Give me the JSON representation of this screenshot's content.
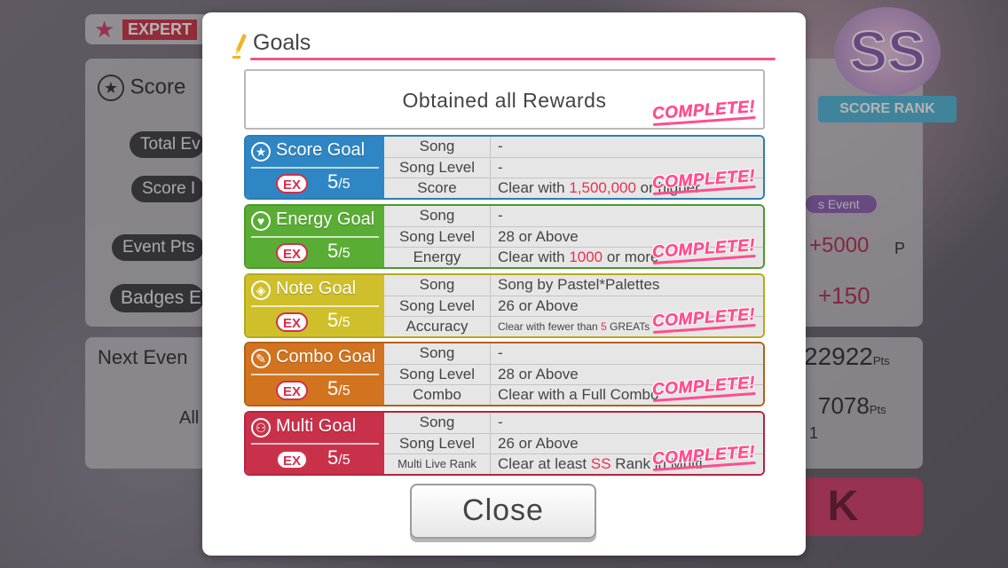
{
  "background": {
    "difficulty": "EXPERT",
    "score_label": "Score",
    "total_label": "Total Ev",
    "score_small": "Score I",
    "event_pts_label": "Event Pts",
    "badges_label": "Badges E",
    "next_event": "Next Even",
    "all_text": "All",
    "score_rank": "SS",
    "score_rank_label": "SCORE RANK",
    "event_label": "s Event",
    "plus_5000": "+5000",
    "p_suffix": "P",
    "plus_150": "+150",
    "pts_1": "22922",
    "pts_2": "7078",
    "pts_unit": "Pts",
    "one": "1"
  },
  "modal": {
    "title": "Goals",
    "all_rewards": "Obtained all Rewards",
    "complete": "COMPLETE!",
    "goals": [
      {
        "name": "Score Goal",
        "icon": "star-icon",
        "ex": "EX",
        "progress": "5",
        "total": "/5",
        "rows": [
          {
            "k": "Song",
            "v": "-"
          },
          {
            "k": "Song Level",
            "v": "-"
          },
          {
            "k": "Score",
            "v_pre": "Clear with ",
            "v_hl": "1,500,000",
            "v_post": " or higher"
          }
        ]
      },
      {
        "name": "Energy Goal",
        "icon": "heart-icon",
        "ex": "EX",
        "progress": "5",
        "total": "/5",
        "rows": [
          {
            "k": "Song",
            "v": "-"
          },
          {
            "k": "Song Level",
            "v": "28 or Above"
          },
          {
            "k": "Energy",
            "v_pre": "Clear with ",
            "v_hl": "1000",
            "v_post": " or more"
          }
        ]
      },
      {
        "name": "Note Goal",
        "icon": "diamond-icon",
        "ex": "EX",
        "progress": "5",
        "total": "/5",
        "rows": [
          {
            "k": "Song",
            "v": "Song by Pastel*Palettes"
          },
          {
            "k": "Song Level",
            "v": "26 or Above"
          },
          {
            "k": "Accuracy",
            "v_pre": "Clear with fewer than ",
            "v_hl": "5",
            "v_post": " GREATs"
          }
        ]
      },
      {
        "name": "Combo Goal",
        "icon": "pen-icon",
        "ex": "EX",
        "progress": "5",
        "total": "/5",
        "rows": [
          {
            "k": "Song",
            "v": "-"
          },
          {
            "k": "Song Level",
            "v": "28 or Above"
          },
          {
            "k": "Combo",
            "v": "Clear with a Full Combo"
          }
        ]
      },
      {
        "name": "Multi Goal",
        "icon": "people-icon",
        "ex": "EX",
        "progress": "5",
        "total": "/5",
        "rows": [
          {
            "k": "Song",
            "v": "-"
          },
          {
            "k": "Song Level",
            "v": "26 or Above"
          },
          {
            "k": "Multi Live Rank",
            "v_pre": "Clear at least ",
            "v_hl": "SS",
            "v_post": " Rank in Multi"
          }
        ]
      }
    ],
    "close": "Close"
  }
}
